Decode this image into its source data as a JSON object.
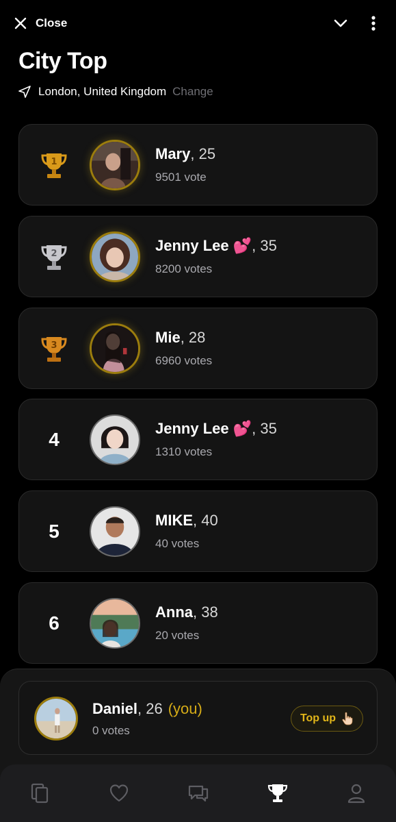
{
  "header": {
    "close_label": "Close",
    "title": "City Top",
    "location": "London, United Kingdom",
    "change_label": "Change"
  },
  "ranking": [
    {
      "rank": "1",
      "trophy": "gold-trophy-1",
      "name": "Mary",
      "age": ", 25",
      "votes": "9501 vote"
    },
    {
      "rank": "2",
      "trophy": "silver-trophy-2",
      "name": "Jenny Lee 💕",
      "age": ", 35",
      "votes": "8200 votes"
    },
    {
      "rank": "3",
      "trophy": "bronze-trophy-3",
      "name": "Mie",
      "age": ", 28",
      "votes": "6960 votes"
    },
    {
      "rank": "4",
      "name": "Jenny Lee 💕",
      "age": ", 35",
      "votes": "1310 votes"
    },
    {
      "rank": "5",
      "name": "MIKE",
      "age": ", 40",
      "votes": "40 votes"
    },
    {
      "rank": "6",
      "name": "Anna",
      "age": ", 38",
      "votes": "20 votes"
    }
  ],
  "me": {
    "name": "Daniel",
    "age": ", 26",
    "you_tag": "(you)",
    "votes": "0 votes",
    "topup_label": "Top up"
  },
  "tabs": [
    {
      "name": "cards-icon",
      "active": false
    },
    {
      "name": "heart-icon",
      "active": false
    },
    {
      "name": "chat-icon",
      "active": false
    },
    {
      "name": "trophy-icon",
      "active": true
    },
    {
      "name": "profile-icon",
      "active": false
    }
  ],
  "colors": {
    "accent_gold": "#D6AC17",
    "background": "#000000",
    "card": "#141414",
    "muted_text": "#A9A9AE"
  }
}
